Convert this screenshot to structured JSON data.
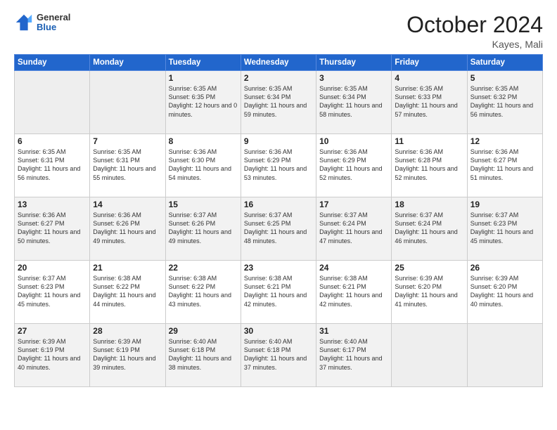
{
  "logo": {
    "general": "General",
    "blue": "Blue"
  },
  "title": "October 2024",
  "location": "Kayes, Mali",
  "days_of_week": [
    "Sunday",
    "Monday",
    "Tuesday",
    "Wednesday",
    "Thursday",
    "Friday",
    "Saturday"
  ],
  "weeks": [
    [
      {
        "day": "",
        "empty": true
      },
      {
        "day": "",
        "empty": true
      },
      {
        "day": "1",
        "sunrise": "Sunrise: 6:35 AM",
        "sunset": "Sunset: 6:35 PM",
        "daylight": "Daylight: 12 hours and 0 minutes."
      },
      {
        "day": "2",
        "sunrise": "Sunrise: 6:35 AM",
        "sunset": "Sunset: 6:34 PM",
        "daylight": "Daylight: 11 hours and 59 minutes."
      },
      {
        "day": "3",
        "sunrise": "Sunrise: 6:35 AM",
        "sunset": "Sunset: 6:34 PM",
        "daylight": "Daylight: 11 hours and 58 minutes."
      },
      {
        "day": "4",
        "sunrise": "Sunrise: 6:35 AM",
        "sunset": "Sunset: 6:33 PM",
        "daylight": "Daylight: 11 hours and 57 minutes."
      },
      {
        "day": "5",
        "sunrise": "Sunrise: 6:35 AM",
        "sunset": "Sunset: 6:32 PM",
        "daylight": "Daylight: 11 hours and 56 minutes."
      }
    ],
    [
      {
        "day": "6",
        "sunrise": "Sunrise: 6:35 AM",
        "sunset": "Sunset: 6:31 PM",
        "daylight": "Daylight: 11 hours and 56 minutes."
      },
      {
        "day": "7",
        "sunrise": "Sunrise: 6:35 AM",
        "sunset": "Sunset: 6:31 PM",
        "daylight": "Daylight: 11 hours and 55 minutes."
      },
      {
        "day": "8",
        "sunrise": "Sunrise: 6:36 AM",
        "sunset": "Sunset: 6:30 PM",
        "daylight": "Daylight: 11 hours and 54 minutes."
      },
      {
        "day": "9",
        "sunrise": "Sunrise: 6:36 AM",
        "sunset": "Sunset: 6:29 PM",
        "daylight": "Daylight: 11 hours and 53 minutes."
      },
      {
        "day": "10",
        "sunrise": "Sunrise: 6:36 AM",
        "sunset": "Sunset: 6:29 PM",
        "daylight": "Daylight: 11 hours and 52 minutes."
      },
      {
        "day": "11",
        "sunrise": "Sunrise: 6:36 AM",
        "sunset": "Sunset: 6:28 PM",
        "daylight": "Daylight: 11 hours and 52 minutes."
      },
      {
        "day": "12",
        "sunrise": "Sunrise: 6:36 AM",
        "sunset": "Sunset: 6:27 PM",
        "daylight": "Daylight: 11 hours and 51 minutes."
      }
    ],
    [
      {
        "day": "13",
        "sunrise": "Sunrise: 6:36 AM",
        "sunset": "Sunset: 6:27 PM",
        "daylight": "Daylight: 11 hours and 50 minutes."
      },
      {
        "day": "14",
        "sunrise": "Sunrise: 6:36 AM",
        "sunset": "Sunset: 6:26 PM",
        "daylight": "Daylight: 11 hours and 49 minutes."
      },
      {
        "day": "15",
        "sunrise": "Sunrise: 6:37 AM",
        "sunset": "Sunset: 6:26 PM",
        "daylight": "Daylight: 11 hours and 49 minutes."
      },
      {
        "day": "16",
        "sunrise": "Sunrise: 6:37 AM",
        "sunset": "Sunset: 6:25 PM",
        "daylight": "Daylight: 11 hours and 48 minutes."
      },
      {
        "day": "17",
        "sunrise": "Sunrise: 6:37 AM",
        "sunset": "Sunset: 6:24 PM",
        "daylight": "Daylight: 11 hours and 47 minutes."
      },
      {
        "day": "18",
        "sunrise": "Sunrise: 6:37 AM",
        "sunset": "Sunset: 6:24 PM",
        "daylight": "Daylight: 11 hours and 46 minutes."
      },
      {
        "day": "19",
        "sunrise": "Sunrise: 6:37 AM",
        "sunset": "Sunset: 6:23 PM",
        "daylight": "Daylight: 11 hours and 45 minutes."
      }
    ],
    [
      {
        "day": "20",
        "sunrise": "Sunrise: 6:37 AM",
        "sunset": "Sunset: 6:23 PM",
        "daylight": "Daylight: 11 hours and 45 minutes."
      },
      {
        "day": "21",
        "sunrise": "Sunrise: 6:38 AM",
        "sunset": "Sunset: 6:22 PM",
        "daylight": "Daylight: 11 hours and 44 minutes."
      },
      {
        "day": "22",
        "sunrise": "Sunrise: 6:38 AM",
        "sunset": "Sunset: 6:22 PM",
        "daylight": "Daylight: 11 hours and 43 minutes."
      },
      {
        "day": "23",
        "sunrise": "Sunrise: 6:38 AM",
        "sunset": "Sunset: 6:21 PM",
        "daylight": "Daylight: 11 hours and 42 minutes."
      },
      {
        "day": "24",
        "sunrise": "Sunrise: 6:38 AM",
        "sunset": "Sunset: 6:21 PM",
        "daylight": "Daylight: 11 hours and 42 minutes."
      },
      {
        "day": "25",
        "sunrise": "Sunrise: 6:39 AM",
        "sunset": "Sunset: 6:20 PM",
        "daylight": "Daylight: 11 hours and 41 minutes."
      },
      {
        "day": "26",
        "sunrise": "Sunrise: 6:39 AM",
        "sunset": "Sunset: 6:20 PM",
        "daylight": "Daylight: 11 hours and 40 minutes."
      }
    ],
    [
      {
        "day": "27",
        "sunrise": "Sunrise: 6:39 AM",
        "sunset": "Sunset: 6:19 PM",
        "daylight": "Daylight: 11 hours and 40 minutes."
      },
      {
        "day": "28",
        "sunrise": "Sunrise: 6:39 AM",
        "sunset": "Sunset: 6:19 PM",
        "daylight": "Daylight: 11 hours and 39 minutes."
      },
      {
        "day": "29",
        "sunrise": "Sunrise: 6:40 AM",
        "sunset": "Sunset: 6:18 PM",
        "daylight": "Daylight: 11 hours and 38 minutes."
      },
      {
        "day": "30",
        "sunrise": "Sunrise: 6:40 AM",
        "sunset": "Sunset: 6:18 PM",
        "daylight": "Daylight: 11 hours and 37 minutes."
      },
      {
        "day": "31",
        "sunrise": "Sunrise: 6:40 AM",
        "sunset": "Sunset: 6:17 PM",
        "daylight": "Daylight: 11 hours and 37 minutes."
      },
      {
        "day": "",
        "empty": true
      },
      {
        "day": "",
        "empty": true
      }
    ]
  ]
}
